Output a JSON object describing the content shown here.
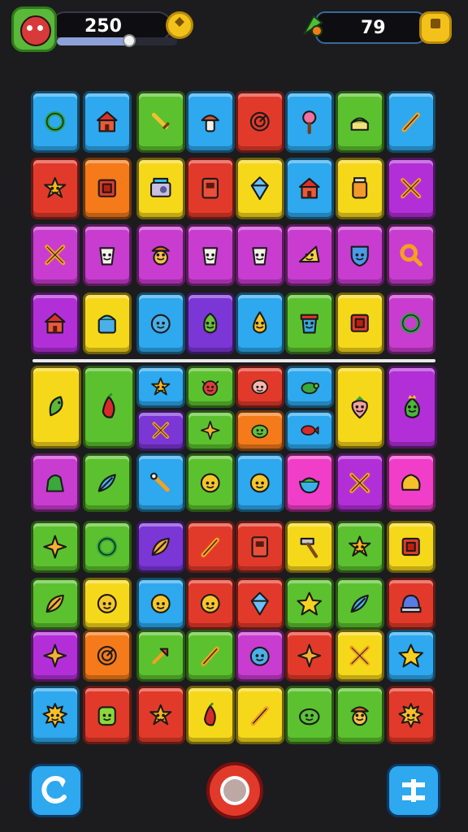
{
  "hud": {
    "score": "250",
    "score_progress": 0.6,
    "moves": "79"
  },
  "colors": {
    "blue": "#2ea8ee",
    "red": "#e23a2a",
    "green": "#5cc12e",
    "orange": "#f47a1a",
    "yellow": "#f6d81a",
    "purple": "#b22fd8",
    "violet": "#7b36d6",
    "pink": "#f03ec8",
    "magenta": "#c93cd0"
  },
  "tiles": [
    {
      "id": "r1c1",
      "color": "blue",
      "icon": "ring-icon"
    },
    {
      "id": "r1c2",
      "color": "blue",
      "icon": "house-icon"
    },
    {
      "id": "r1c3",
      "color": "green",
      "icon": "sword-icon"
    },
    {
      "id": "r1c4",
      "color": "blue",
      "icon": "mushroom-icon"
    },
    {
      "id": "r1c5",
      "color": "red",
      "icon": "target-icon"
    },
    {
      "id": "r1c6",
      "color": "blue",
      "icon": "lollipop-icon"
    },
    {
      "id": "r1c7",
      "color": "green",
      "icon": "cake-icon"
    },
    {
      "id": "r1c8",
      "color": "blue",
      "icon": "pencil-icon"
    },
    {
      "id": "r2c1",
      "color": "red",
      "icon": "star-face-icon"
    },
    {
      "id": "r2c2",
      "color": "orange",
      "icon": "box-icon"
    },
    {
      "id": "r2c3",
      "color": "yellow",
      "icon": "radio-icon"
    },
    {
      "id": "r2c4",
      "color": "red",
      "icon": "cabinet-icon"
    },
    {
      "id": "r2c5",
      "color": "yellow",
      "icon": "gem-icon"
    },
    {
      "id": "r2c6",
      "color": "blue",
      "icon": "house-icon"
    },
    {
      "id": "r2c7",
      "color": "yellow",
      "icon": "jar-icon"
    },
    {
      "id": "r2c8",
      "color": "purple",
      "icon": "crossed-swords-icon"
    },
    {
      "id": "r3c1",
      "color": "magenta",
      "icon": "crossed-swords-icon"
    },
    {
      "id": "r3c2",
      "color": "magenta",
      "icon": "cup-face-icon"
    },
    {
      "id": "r3c3",
      "color": "magenta",
      "icon": "hat-face-icon"
    },
    {
      "id": "r3c4",
      "color": "magenta",
      "icon": "cup-face-icon"
    },
    {
      "id": "r3c5",
      "color": "magenta",
      "icon": "cup-face-icon"
    },
    {
      "id": "r3c6",
      "color": "magenta",
      "icon": "cheese-face-icon"
    },
    {
      "id": "r3c7",
      "color": "magenta",
      "icon": "shield-icon"
    },
    {
      "id": "r3c8",
      "color": "magenta",
      "icon": "magnifier-icon"
    },
    {
      "id": "r4c1",
      "color": "purple",
      "icon": "house-icon"
    },
    {
      "id": "r4c2",
      "color": "yellow",
      "icon": "basket-icon"
    },
    {
      "id": "r4c3",
      "color": "blue",
      "icon": "blob-face-icon"
    },
    {
      "id": "r4c4",
      "color": "violet",
      "icon": "pepper-face-icon"
    },
    {
      "id": "r4c5",
      "color": "blue",
      "icon": "drop-face-icon"
    },
    {
      "id": "r4c6",
      "color": "green",
      "icon": "pot-face-icon"
    },
    {
      "id": "r4c7",
      "color": "yellow",
      "icon": "box-icon"
    },
    {
      "id": "r4c8",
      "color": "magenta",
      "icon": "ring-icon"
    },
    {
      "id": "b1",
      "color": "yellow",
      "icon": "cucumber-icon",
      "big": true
    },
    {
      "id": "b2",
      "color": "green",
      "icon": "chili-icon",
      "big": true
    },
    {
      "id": "b3",
      "color": "blue",
      "icon": "star-face-icon"
    },
    {
      "id": "b4",
      "color": "green",
      "icon": "crab-face-icon"
    },
    {
      "id": "b5",
      "color": "red",
      "icon": "pig-face-icon"
    },
    {
      "id": "b6",
      "color": "blue",
      "icon": "turtle-icon"
    },
    {
      "id": "b7",
      "color": "yellow",
      "icon": "strawberry-face-icon",
      "big": true
    },
    {
      "id": "b8",
      "color": "purple",
      "icon": "crown-pepper-icon",
      "big": true
    },
    {
      "id": "b9",
      "color": "violet",
      "icon": "crossed-swords-icon"
    },
    {
      "id": "b10",
      "color": "green",
      "icon": "shuriken-icon"
    },
    {
      "id": "b11",
      "color": "orange",
      "icon": "frog-face-icon"
    },
    {
      "id": "b12",
      "color": "blue",
      "icon": "fish-icon"
    },
    {
      "id": "r6c1",
      "color": "magenta",
      "icon": "dino-icon"
    },
    {
      "id": "r6c2",
      "color": "green",
      "icon": "feather-icon"
    },
    {
      "id": "r6c3",
      "color": "blue",
      "icon": "wand-icon"
    },
    {
      "id": "r6c4",
      "color": "green",
      "icon": "smile-face-icon"
    },
    {
      "id": "r6c5",
      "color": "blue",
      "icon": "smile-face-icon"
    },
    {
      "id": "r6c6",
      "color": "pink",
      "icon": "bowl-icon"
    },
    {
      "id": "r6c7",
      "color": "purple",
      "icon": "crossed-swords-icon"
    },
    {
      "id": "r6c8",
      "color": "pink",
      "icon": "cheese-icon"
    },
    {
      "id": "r7c1",
      "color": "green",
      "icon": "shuriken-icon"
    },
    {
      "id": "r7c2",
      "color": "green",
      "icon": "ring-icon"
    },
    {
      "id": "r7c3",
      "color": "violet",
      "icon": "leaf-icon"
    },
    {
      "id": "r7c4",
      "color": "red",
      "icon": "pencil-icon"
    },
    {
      "id": "r7c5",
      "color": "red",
      "icon": "cabinet-icon"
    },
    {
      "id": "r7c6",
      "color": "yellow",
      "icon": "hammer-icon"
    },
    {
      "id": "r7c7",
      "color": "green",
      "icon": "star-face-icon"
    },
    {
      "id": "r7c8",
      "color": "yellow",
      "icon": "box-icon"
    },
    {
      "id": "r8c1",
      "color": "green",
      "icon": "leaf-icon"
    },
    {
      "id": "r8c2",
      "color": "yellow",
      "icon": "smile-face-icon"
    },
    {
      "id": "r8c3",
      "color": "blue",
      "icon": "smile-face-icon"
    },
    {
      "id": "r8c4",
      "color": "red",
      "icon": "smile-face-icon"
    },
    {
      "id": "r8c5",
      "color": "red",
      "icon": "gem-icon"
    },
    {
      "id": "r8c6",
      "color": "green",
      "icon": "star-icon"
    },
    {
      "id": "r8c7",
      "color": "green",
      "icon": "feather-icon"
    },
    {
      "id": "r8c8",
      "color": "red",
      "icon": "helmet-icon"
    },
    {
      "id": "r9c1",
      "color": "purple",
      "icon": "shuriken-icon"
    },
    {
      "id": "r9c2",
      "color": "orange",
      "icon": "target-icon"
    },
    {
      "id": "r9c3",
      "color": "green",
      "icon": "arrow-icon"
    },
    {
      "id": "r9c4",
      "color": "green",
      "icon": "pencil-icon"
    },
    {
      "id": "r9c5",
      "color": "magenta",
      "icon": "blob-face-icon"
    },
    {
      "id": "r9c6",
      "color": "red",
      "icon": "shuriken-icon"
    },
    {
      "id": "r9c7",
      "color": "yellow",
      "icon": "crossed-swords-icon"
    },
    {
      "id": "r9c8",
      "color": "blue",
      "icon": "star-icon"
    },
    {
      "id": "r10c1",
      "color": "blue",
      "icon": "sun-face-icon"
    },
    {
      "id": "r10c2",
      "color": "red",
      "icon": "monster-face-icon"
    },
    {
      "id": "r10c3",
      "color": "red",
      "icon": "star-face-icon"
    },
    {
      "id": "r10c4",
      "color": "yellow",
      "icon": "chili-icon"
    },
    {
      "id": "r10c5",
      "color": "yellow",
      "icon": "pencil-icon"
    },
    {
      "id": "r10c6",
      "color": "green",
      "icon": "frog-face-icon"
    },
    {
      "id": "r10c7",
      "color": "green",
      "icon": "hat-face-icon"
    },
    {
      "id": "r10c8",
      "color": "red",
      "icon": "sun-face-icon"
    }
  ],
  "bottom_bar": {
    "left_button_icon": "shuffle-icon",
    "center_button_icon": "record-icon",
    "right_button_icon": "hint-icon"
  }
}
